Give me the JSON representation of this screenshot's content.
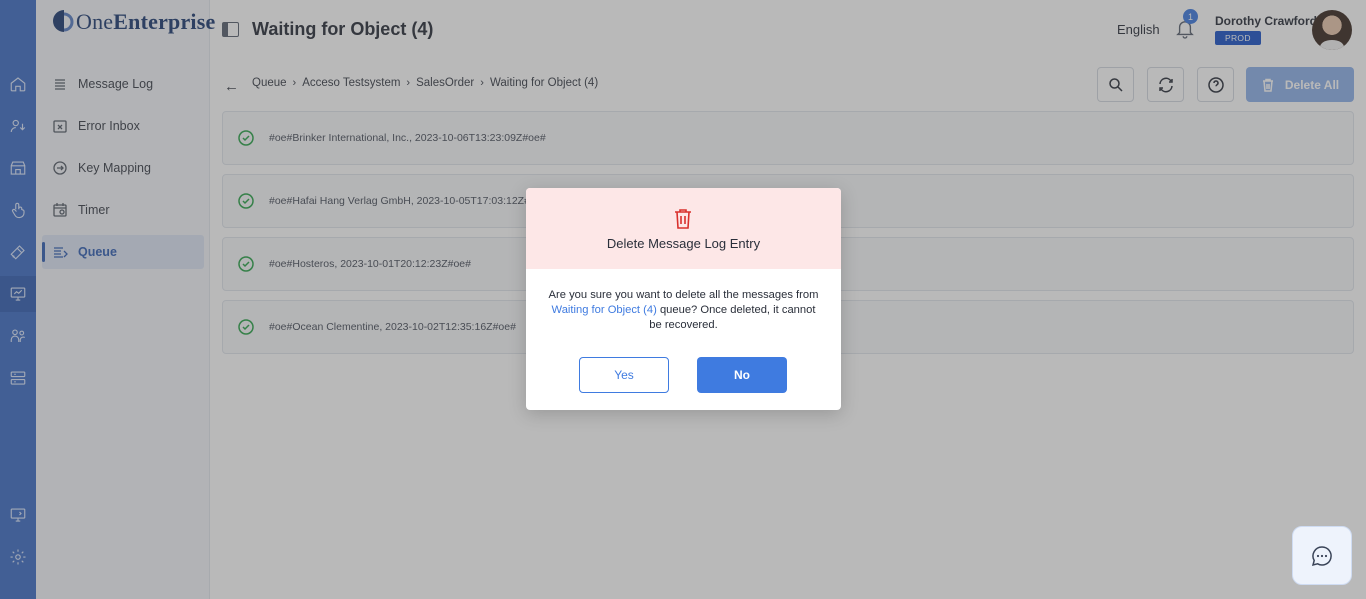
{
  "app": {
    "name_part1": "One",
    "name_part2": "Enterprise"
  },
  "header": {
    "title": "Waiting for Object (4)",
    "language": "English",
    "notification_count": "1",
    "user_name": "Dorothy Crawford",
    "environment": "PROD"
  },
  "rail": {
    "icons": [
      "home-icon",
      "user-switch-icon",
      "store-icon",
      "touch-icon",
      "tools-icon",
      "monitor-chart-icon",
      "team-icon",
      "server-icon",
      "remote-desktop-icon",
      "settings-icon"
    ]
  },
  "sidebar": {
    "items": [
      {
        "label": "Message Log",
        "icon": "list-icon"
      },
      {
        "label": "Error Inbox",
        "icon": "error-inbox-icon"
      },
      {
        "label": "Key Mapping",
        "icon": "key-icon"
      },
      {
        "label": "Timer",
        "icon": "timer-icon"
      },
      {
        "label": "Queue",
        "icon": "queue-icon"
      }
    ]
  },
  "breadcrumb": {
    "items": [
      "Queue",
      "Acceso Testsystem",
      "SalesOrder",
      "Waiting for Object (4)"
    ]
  },
  "toolbar": {
    "delete_all_label": "Delete All"
  },
  "rows": [
    {
      "text": "#oe#Brinker International, Inc., 2023-10-06T13:23:09Z#oe#"
    },
    {
      "text": "#oe#Hafai Hang Verlag GmbH, 2023-10-05T17:03:12Z#oe#"
    },
    {
      "text": "#oe#Hosteros, 2023-10-01T20:12:23Z#oe#"
    },
    {
      "text": "#oe#Ocean Clementine, 2023-10-02T12:35:16Z#oe#"
    }
  ],
  "modal": {
    "title": "Delete Message Log Entry",
    "body_prefix": "Are you sure you want to delete all the messages from",
    "body_link": "Waiting for Object (4)",
    "body_suffix": "queue? Once deleted, it cannot be recovered.",
    "yes_label": "Yes",
    "no_label": "No"
  },
  "colors": {
    "accent": "#3f7be0",
    "rail": "#3f6fc6",
    "danger": "#d9302d",
    "success": "#2aa44a",
    "modal_header": "#fde7e7"
  }
}
